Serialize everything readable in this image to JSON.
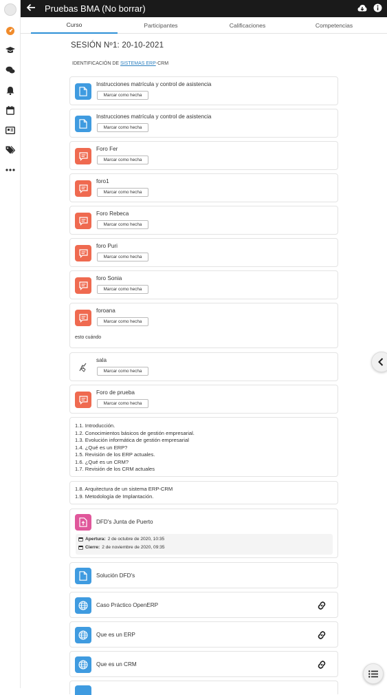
{
  "header": {
    "title": "Pruebas BMA (No borrar)"
  },
  "tabs": [
    {
      "label": "Curso",
      "active": true
    },
    {
      "label": "Participantes",
      "active": false
    },
    {
      "label": "Calificaciones",
      "active": false
    },
    {
      "label": "Competencias",
      "active": false
    }
  ],
  "section": {
    "title": "SESIÓN Nº1: 20-10-2021",
    "subtitle_prefix": "IDENTIFICACIÓN DE ",
    "subtitle_link": "SISTEMAS ERP",
    "subtitle_suffix": "-CRM"
  },
  "mark_label": "Marcar como hecha",
  "modules": [
    {
      "name": "Instrucciones matrícula y control de asistencia",
      "type": "resource"
    },
    {
      "name": "Instrucciones matrícula y control de asistencia",
      "type": "resource"
    },
    {
      "name": "Foro Fer",
      "type": "forum"
    },
    {
      "name": "foro1",
      "type": "forum"
    },
    {
      "name": "Foro Rebeca",
      "type": "forum"
    },
    {
      "name": "foro Puri",
      "type": "forum"
    },
    {
      "name": "foro Sonia",
      "type": "forum"
    },
    {
      "name": "foroana",
      "type": "forum",
      "note": "esto cuándo"
    },
    {
      "name": "sala",
      "type": "chat"
    },
    {
      "name": "Foro de prueba",
      "type": "forum"
    }
  ],
  "label_block_1": [
    "1.1. Introducción.",
    "1.2. Conocimientos básicos de gestión empresarial.",
    "1.3. Evolución informática de gestión empresarial",
    "1.4. ¿Qué es un ERP?",
    "1.5. Revisión de los ERP actuales.",
    "1.6. ¿Qué es un CRM?",
    "1.7. Revisión de los CRM actuales"
  ],
  "label_block_2": [
    "1.8. Arquitectura de un sistema ERP-CRM",
    "1.9. Metodología de Implantación."
  ],
  "assignment": {
    "name": "DFD's Junta de Puerto",
    "open_label": "Apertura:",
    "open_value": "2 de octubre de 2020, 10:35",
    "close_label": "Cierre:",
    "close_value": "2 de noviembre de 2020, 09:35"
  },
  "resource_solution": {
    "name": "Solución DFD's"
  },
  "url_modules": [
    {
      "name": "Caso Práctico OpenERP"
    },
    {
      "name": "Que es un ERP"
    },
    {
      "name": "Que es un CRM"
    }
  ],
  "colors": {
    "resource": "#3f9be0",
    "forum": "#ef6a50",
    "assign": "#e0579b",
    "topbar": "#1a1a1a",
    "active_tab": "#2b8fd6",
    "dashboard_icon": "#f08b2b"
  }
}
